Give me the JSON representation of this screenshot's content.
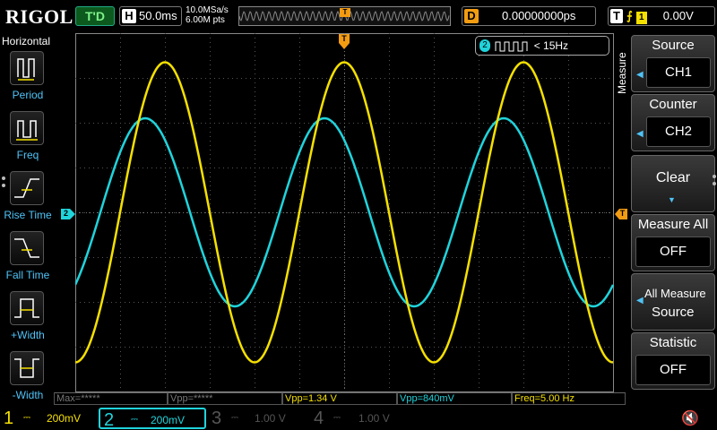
{
  "header": {
    "brand": "RIGOL",
    "trigger_status": "T'D",
    "horizontal_label": "H",
    "timebase": "50.0ms",
    "sample_rate": "10.0MSa/s",
    "memory_depth": "6.00M pts",
    "delay_label": "D",
    "delay": "0.00000000ps",
    "trigger_label": "T",
    "trigger_edge": "⨍",
    "trigger_source": "1",
    "trigger_level": "0.00V"
  },
  "left_menu": {
    "title": "Horizontal",
    "items": [
      {
        "label": "Period",
        "icon": "period-icon"
      },
      {
        "label": "Freq",
        "icon": "freq-icon"
      },
      {
        "label": "Rise Time",
        "icon": "rise-time-icon"
      },
      {
        "label": "Fall Time",
        "icon": "fall-time-icon"
      },
      {
        "label": "+Width",
        "icon": "pos-width-icon"
      },
      {
        "label": "-Width",
        "icon": "neg-width-icon"
      }
    ]
  },
  "counter_badge": {
    "channel": "2",
    "text": "< 15Hz"
  },
  "trigger_marker": "T",
  "ch2_marker": "2",
  "measurements": [
    {
      "text": "Max=*****",
      "state": "inactive"
    },
    {
      "text": "Vpp=*****",
      "state": "inactive"
    },
    {
      "text": "Vpp=1.34 V",
      "state": "ch1"
    },
    {
      "text": "Vpp=840mV",
      "state": "ch2"
    },
    {
      "text": "Freq=5.00 Hz",
      "state": "ch1"
    }
  ],
  "right_menu": {
    "side_title": "Measure",
    "source": {
      "title": "Source",
      "value": "CH1"
    },
    "counter": {
      "title": "Counter",
      "value": "CH2"
    },
    "clear": {
      "title": "Clear"
    },
    "measure_all": {
      "title": "Measure All",
      "value": "OFF"
    },
    "all_measure_source": {
      "line1": "All Measure",
      "line2": "Source"
    },
    "statistic": {
      "title": "Statistic",
      "value": "OFF"
    }
  },
  "channels": [
    {
      "num": "1",
      "coupling": "⎓",
      "scale": "200mV"
    },
    {
      "num": "2",
      "coupling": "⎓",
      "scale": "200mV"
    },
    {
      "num": "3",
      "coupling": "⎓",
      "scale": "1.00 V"
    },
    {
      "num": "4",
      "coupling": "⎓",
      "scale": "1.00 V"
    }
  ],
  "colors": {
    "ch1": "#f5e000",
    "ch2": "#20d4dc",
    "accent": "#f39c12"
  },
  "waveforms": {
    "ch1": {
      "type": "sine",
      "frequency_hz": 5.0,
      "vpp_v": 1.34
    },
    "ch2": {
      "type": "sine",
      "frequency_hz": 5.0,
      "vpp_v": 0.84
    }
  }
}
